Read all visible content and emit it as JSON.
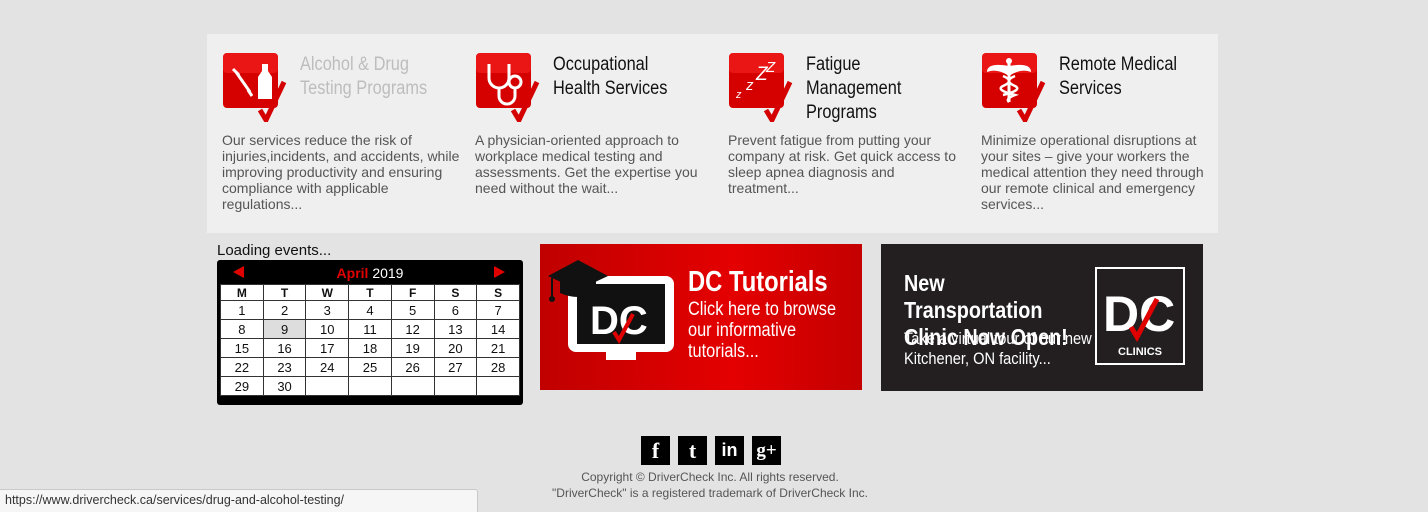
{
  "services": [
    {
      "title": "Alcohol & Drug\nTesting Programs",
      "icon": "bottle-syringe-icon",
      "description": "Our services reduce the risk of injuries,incidents, and accidents, while improving productivity and ensuring compliance with applicable regulations..."
    },
    {
      "title": "Occupational\nHealth Services",
      "icon": "stethoscope-icon",
      "description": "A physician-oriented approach to workplace medical testing and assessments. Get the expertise you need without the wait..."
    },
    {
      "title": "Fatigue Management\nPrograms",
      "icon": "sleep-zzz-icon",
      "description": "Prevent fatigue from putting your company at risk. Get quick access to sleep apnea diagnosis and treatment..."
    },
    {
      "title": "Remote Medical\nServices",
      "icon": "caduceus-icon",
      "description": "Minimize operational disruptions at your sites – give your workers the medical attention they need through our remote clinical and emergency services..."
    }
  ],
  "calendar": {
    "loading_text": "Loading events...",
    "month": "April",
    "year": "2019",
    "weekdays": [
      "M",
      "T",
      "W",
      "T",
      "F",
      "S",
      "S"
    ],
    "weeks": [
      [
        "1",
        "2",
        "3",
        "4",
        "5",
        "6",
        "7"
      ],
      [
        "8",
        "9",
        "10",
        "11",
        "12",
        "13",
        "14"
      ],
      [
        "15",
        "16",
        "17",
        "18",
        "19",
        "20",
        "21"
      ],
      [
        "22",
        "23",
        "24",
        "25",
        "26",
        "27",
        "28"
      ],
      [
        "29",
        "30",
        "",
        "",
        "",
        "",
        ""
      ]
    ],
    "highlighted_day": "9"
  },
  "tutorials_banner": {
    "title": "DC Tutorials",
    "subtitle": "Click here to browse our informative tutorials...",
    "logo_text": "DC"
  },
  "clinic_banner": {
    "title": "New Transportation Clinic Now Open!",
    "subtitle": "Take a virtual tour of our new Kitchener, ON facility...",
    "logo_text": "DC",
    "logo_caption": "CLINICS"
  },
  "social": [
    {
      "name": "facebook-icon",
      "glyph": "f"
    },
    {
      "name": "twitter-icon",
      "glyph": "t"
    },
    {
      "name": "linkedin-icon",
      "glyph": "in"
    },
    {
      "name": "google-plus-icon",
      "glyph": "g+"
    }
  ],
  "footer": {
    "copyright": "Copyright © DriverCheck Inc. All rights reserved.",
    "trademark": "\"DriverCheck\" is a registered trademark of DriverCheck Inc."
  },
  "status_url": "https://www.drivercheck.ca/services/drug-and-alcohol-testing/",
  "colors": {
    "accent": "#e00000",
    "dark_banner": "#231f20",
    "background": "#e3e3e3"
  }
}
